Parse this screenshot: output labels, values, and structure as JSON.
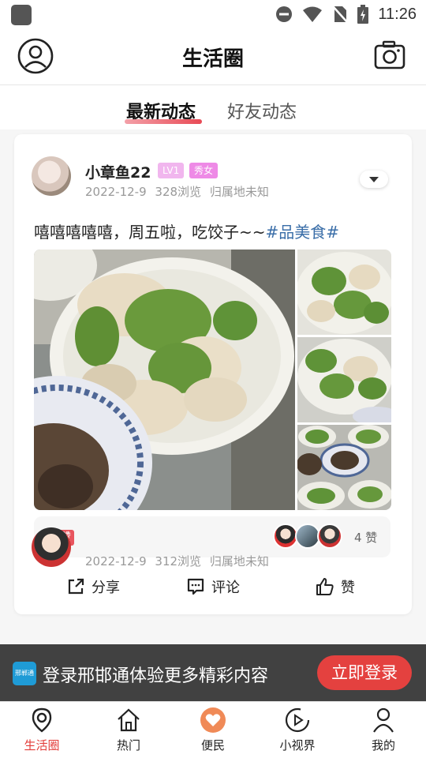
{
  "status_bar": {
    "time": "11:26",
    "icons": [
      "app-icon",
      "do-not-disturb-icon",
      "wifi-icon",
      "no-sim-icon",
      "battery-charging-icon"
    ]
  },
  "header": {
    "title": "生活圈",
    "left_icon": "user-avatar-icon",
    "right_icon": "camera-icon"
  },
  "tabs": [
    {
      "label": "最新动态",
      "active": true
    },
    {
      "label": "好友动态",
      "active": false
    }
  ],
  "post": {
    "username": "小章鱼22",
    "level_badge": "LV1",
    "tag_badge": "秀女",
    "date": "2022-12-9",
    "views": "328浏览",
    "location": "归属地未知",
    "text": "嘻嘻嘻嘻嘻，周五啦，吃饺子~~",
    "topic": "#品美食#",
    "like_tag": "点赞",
    "like_count": "4 赞",
    "actions": {
      "share": "分享",
      "comment": "评论",
      "like": "赞"
    }
  },
  "next_post": {
    "date": "2022-12-9",
    "views": "312浏览",
    "location": "归属地未知"
  },
  "login_banner": {
    "logo_text": "邢郸通",
    "text": "登录邢邯通体验更多精彩内容",
    "button": "立即登录"
  },
  "bottom_nav": [
    {
      "label": "生活圈",
      "icon": "location-pin-icon",
      "active": true
    },
    {
      "label": "热门",
      "icon": "home-icon",
      "active": false
    },
    {
      "label": "便民",
      "icon": "heart-icon",
      "active": false
    },
    {
      "label": "小视界",
      "icon": "video-play-icon",
      "active": false
    },
    {
      "label": "我的",
      "icon": "person-icon",
      "active": false
    }
  ],
  "colors": {
    "accent": "#e33d3a",
    "topic_link": "#3a6ea8",
    "badge_pink": "#ee8ae6",
    "heart_orange": "#f08a57"
  }
}
